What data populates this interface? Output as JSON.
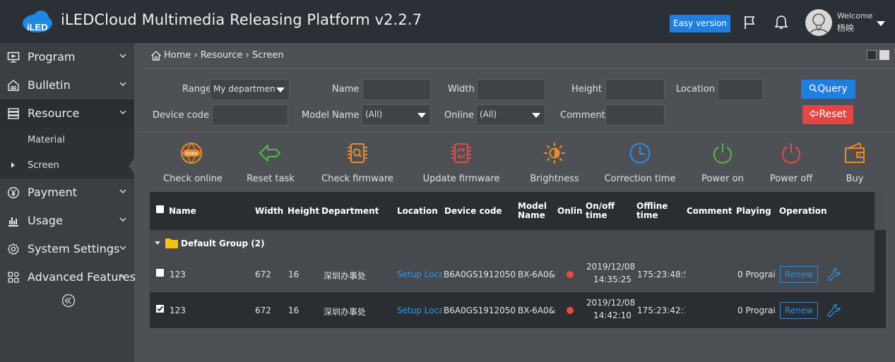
{
  "header": {
    "app_title": "iLEDCloud Multimedia Releasing Platform v2.2.7",
    "logo_text": "iLED",
    "easy_version_label": "Easy version",
    "welcome_label": "Welcome",
    "user_name": "杨映"
  },
  "sidebar": {
    "items": [
      {
        "label": "Program",
        "icon": "monitor-icon"
      },
      {
        "label": "Bulletin",
        "icon": "bulletin-icon"
      },
      {
        "label": "Resource",
        "icon": "resource-icon"
      },
      {
        "label": "Payment",
        "icon": "yen-icon"
      },
      {
        "label": "Usage",
        "icon": "bar-chart-icon"
      },
      {
        "label": "System Settings",
        "icon": "gear-icon"
      },
      {
        "label": "Advanced Features",
        "icon": "grid-icon"
      }
    ],
    "sub_items": [
      {
        "label": "Material"
      },
      {
        "label": "Screen"
      }
    ]
  },
  "breadcrumb": {
    "text": "Home › Resource › Screen"
  },
  "filters": {
    "range_label": "Range",
    "range_value": "My departmen",
    "name_label": "Name",
    "width_label": "Width",
    "height_label": "Height",
    "location_label": "Location",
    "device_code_label": "Device code",
    "model_name_label": "Model Name",
    "model_name_value": "(All)",
    "online_label": "Online",
    "online_value": "(All)",
    "comment_label": "Comment",
    "query_label": "Query",
    "reset_label": "Reset"
  },
  "actions": [
    {
      "label": "Check online",
      "icon": "globe-online-icon",
      "color": "#f08a24"
    },
    {
      "label": "Reset task",
      "icon": "reset-task-icon",
      "color": "#52b848"
    },
    {
      "label": "Check firmware",
      "icon": "check-firmware-icon",
      "color": "#f08a24"
    },
    {
      "label": "Update firmware",
      "icon": "update-firmware-icon",
      "color": "#e84a45"
    },
    {
      "label": "Brightness",
      "icon": "brightness-icon",
      "color": "#f08a24"
    },
    {
      "label": "Correction time",
      "icon": "clock-icon",
      "color": "#2d8ee8"
    },
    {
      "label": "Power on",
      "icon": "power-on-icon",
      "color": "#52b848"
    },
    {
      "label": "Power off",
      "icon": "power-off-icon",
      "color": "#e84a45"
    },
    {
      "label": "Buy",
      "icon": "wallet-icon",
      "color": "#f08a24"
    }
  ],
  "table": {
    "headers": {
      "name": "Name",
      "width": "Width",
      "height": "Height",
      "department": "Department",
      "location": "Location",
      "device_code": "Device code",
      "model_name_1": "Model",
      "model_name_2": "Name",
      "online": "Online",
      "onoff_1": "On/off",
      "onoff_2": "time",
      "offline_1": "Offline",
      "offline_2": "time",
      "comment": "Comment",
      "playing": "Playing",
      "operation": "Operation"
    },
    "group": "Default Group (2)",
    "rows": [
      {
        "checked": false,
        "name": "123",
        "width": "672",
        "height": "16",
        "department": "深圳办事处",
        "location": "Setup Loca",
        "device_code": "B6A0GS1912050",
        "model_name": "BX-6A0&",
        "onoff_date": "2019/12/08",
        "onoff_time": "14:35:25",
        "offline_time": "175:23:48:5",
        "playing": "0 Prograi",
        "renew_label": "Renew"
      },
      {
        "checked": true,
        "name": "123",
        "width": "672",
        "height": "16",
        "department": "深圳办事处",
        "location": "Setup Loca",
        "device_code": "B6A0GS1912050",
        "model_name": "BX-6A0&",
        "onoff_date": "2019/12/08",
        "onoff_time": "14:42:10",
        "offline_time": "175:23:42:1",
        "playing": "0 Prograi",
        "renew_label": "Renew"
      }
    ]
  },
  "colors": {
    "accent_blue": "#1e7fe0",
    "reset_red": "#e64545",
    "offline_dot": "#e84a45",
    "folder_yellow": "#f4c20d"
  }
}
